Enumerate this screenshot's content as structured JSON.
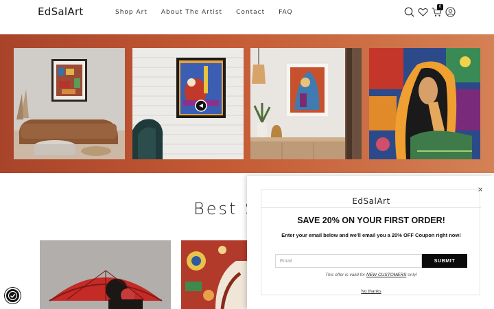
{
  "header": {
    "logo": "EdSalArt",
    "nav": [
      "Shop Art",
      "About The Artist",
      "Contact",
      "FAQ"
    ],
    "icons": [
      "search-icon",
      "heart-icon",
      "cart-icon",
      "account-icon"
    ],
    "cart_count": "0"
  },
  "banner": {
    "gradient_colors": [
      "#a8442a",
      "#c45a35",
      "#d48155"
    ]
  },
  "best_sellers": {
    "title": "Best S"
  },
  "popup": {
    "brand": "EdSalArt",
    "close": "×",
    "heading": "SAVE 20% ON YOUR FIRST ORDER!",
    "subtext": "Enter your email below and we'll email you a 20% OFF Coupon right now!",
    "email_placeholder": "Email",
    "submit_label": "SUBMIT",
    "offer_prefix": "This offer is valid for ",
    "offer_link": "NEW CUSTOMERS",
    "offer_suffix": " only!",
    "no_thanks": "No thanks"
  },
  "cookie_badge_icon": "cookie-settings-icon"
}
